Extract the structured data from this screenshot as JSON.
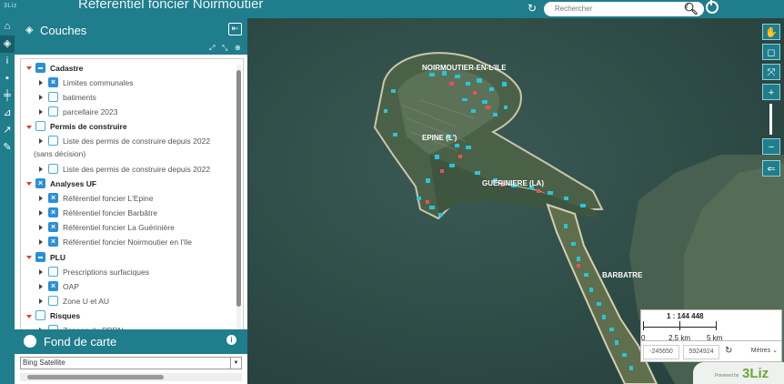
{
  "header": {
    "title": "Référentiel foncier Noirmoutier",
    "logo_text": "3Liz",
    "search_placeholder": "Rechercher"
  },
  "rail": {
    "icons": [
      "home-icon",
      "layers-icon",
      "info-icon",
      "comment-icon",
      "edit-icon",
      "measure-icon",
      "share-icon",
      "pencil-icon"
    ]
  },
  "layers_panel": {
    "title": "Couches",
    "tree": {
      "cadastre": {
        "label": "Cadastre",
        "items": [
          "Limites communales",
          "batiments",
          "parcellaire 2023"
        ]
      },
      "permis": {
        "label": "Permis de construire",
        "item1_line1": "Liste des permis de construire depuis 2022",
        "item1_line2": "(sans décision)",
        "item2": "Liste des permis de construire depuis 2022"
      },
      "analyses": {
        "label": "Analyses UF",
        "items": [
          "Référentiel foncier L'Epine",
          "Référentiel foncier Barbâtre",
          "Référentiel foncier La Guérinière",
          "Référentiel foncier Noirmoutier en l'Ile"
        ]
      },
      "plu": {
        "label": "PLU",
        "items": [
          "Prescriptions surfaciques",
          "OAP",
          "Zone U et AU"
        ]
      },
      "risques": {
        "label": "Risques",
        "items": [
          "Zonage du PPRN"
        ]
      }
    }
  },
  "basemap": {
    "title": "Fond de carte",
    "selected": "Bing Satellite"
  },
  "map": {
    "labels": [
      "NOIRMOUTIER-EN-L'ILE",
      "EPINE (L')",
      "GUERINIERE (LA)",
      "BARBATRE"
    ]
  },
  "scale": {
    "title": "1 : 144 448",
    "labels": [
      "0",
      "2.5 km",
      "5 km"
    ]
  },
  "coordinates": {
    "x": "-245650",
    "y": "5924924",
    "units": "Mètres"
  },
  "badge": {
    "powered_by": "Powered by",
    "brand": "3Liz"
  }
}
